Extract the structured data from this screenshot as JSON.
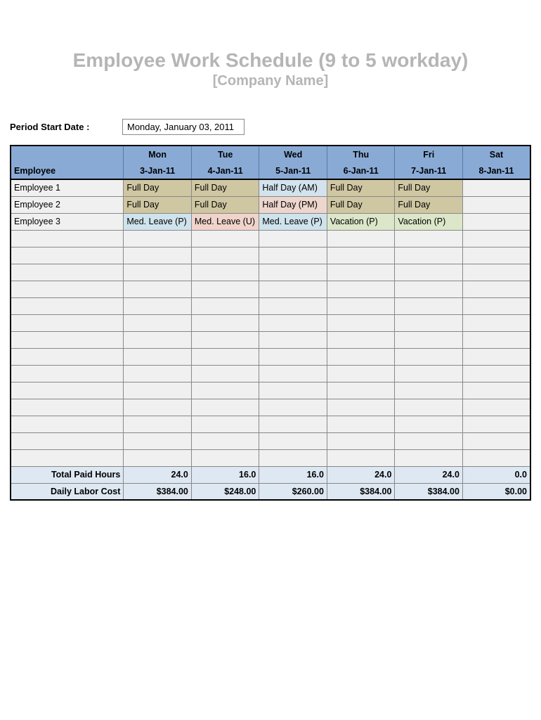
{
  "header": {
    "title": "Employee Work Schedule (9 to 5  workday)",
    "subtitle": "[Company Name]"
  },
  "period": {
    "label": "Period Start Date :",
    "value": "Monday, January 03, 2011"
  },
  "table": {
    "employee_header": "Employee",
    "days": [
      {
        "dow": "Mon",
        "date": "3-Jan-11"
      },
      {
        "dow": "Tue",
        "date": "4-Jan-11"
      },
      {
        "dow": "Wed",
        "date": "5-Jan-11"
      },
      {
        "dow": "Thu",
        "date": "6-Jan-11"
      },
      {
        "dow": "Fri",
        "date": "7-Jan-11"
      },
      {
        "dow": "Sat",
        "date": "8-Jan-11"
      }
    ],
    "rows": [
      {
        "employee": "Employee 1",
        "cells": [
          {
            "text": "Full Day",
            "cls": "c-fullday"
          },
          {
            "text": "Full Day",
            "cls": "c-fullday"
          },
          {
            "text": "Half Day (AM)",
            "cls": "c-halfam"
          },
          {
            "text": "Full Day",
            "cls": "c-fullday"
          },
          {
            "text": "Full Day",
            "cls": "c-fullday"
          },
          {
            "text": "",
            "cls": "c-none"
          }
        ]
      },
      {
        "employee": "Employee 2",
        "cells": [
          {
            "text": "Full Day",
            "cls": "c-fullday"
          },
          {
            "text": "Full Day",
            "cls": "c-fullday"
          },
          {
            "text": "Half Day (PM)",
            "cls": "c-halfpm"
          },
          {
            "text": "Full Day",
            "cls": "c-fullday"
          },
          {
            "text": "Full Day",
            "cls": "c-fullday"
          },
          {
            "text": "",
            "cls": "c-none"
          }
        ]
      },
      {
        "employee": "Employee 3",
        "cells": [
          {
            "text": "Med. Leave (P)",
            "cls": "c-medp"
          },
          {
            "text": "Med. Leave (U)",
            "cls": "c-medu"
          },
          {
            "text": "Med. Leave (P)",
            "cls": "c-medp"
          },
          {
            "text": "Vacation (P)",
            "cls": "c-vacp"
          },
          {
            "text": "Vacation (P)",
            "cls": "c-vacp"
          },
          {
            "text": "",
            "cls": "c-none"
          }
        ]
      },
      {
        "employee": "",
        "cells": [
          {
            "text": "",
            "cls": "c-none"
          },
          {
            "text": "",
            "cls": "c-none"
          },
          {
            "text": "",
            "cls": "c-none"
          },
          {
            "text": "",
            "cls": "c-none"
          },
          {
            "text": "",
            "cls": "c-none"
          },
          {
            "text": "",
            "cls": "c-none"
          }
        ]
      },
      {
        "employee": "",
        "cells": [
          {
            "text": "",
            "cls": "c-none"
          },
          {
            "text": "",
            "cls": "c-none"
          },
          {
            "text": "",
            "cls": "c-none"
          },
          {
            "text": "",
            "cls": "c-none"
          },
          {
            "text": "",
            "cls": "c-none"
          },
          {
            "text": "",
            "cls": "c-none"
          }
        ]
      },
      {
        "employee": "",
        "cells": [
          {
            "text": "",
            "cls": "c-none"
          },
          {
            "text": "",
            "cls": "c-none"
          },
          {
            "text": "",
            "cls": "c-none"
          },
          {
            "text": "",
            "cls": "c-none"
          },
          {
            "text": "",
            "cls": "c-none"
          },
          {
            "text": "",
            "cls": "c-none"
          }
        ]
      },
      {
        "employee": "",
        "cells": [
          {
            "text": "",
            "cls": "c-none"
          },
          {
            "text": "",
            "cls": "c-none"
          },
          {
            "text": "",
            "cls": "c-none"
          },
          {
            "text": "",
            "cls": "c-none"
          },
          {
            "text": "",
            "cls": "c-none"
          },
          {
            "text": "",
            "cls": "c-none"
          }
        ]
      },
      {
        "employee": "",
        "cells": [
          {
            "text": "",
            "cls": "c-none"
          },
          {
            "text": "",
            "cls": "c-none"
          },
          {
            "text": "",
            "cls": "c-none"
          },
          {
            "text": "",
            "cls": "c-none"
          },
          {
            "text": "",
            "cls": "c-none"
          },
          {
            "text": "",
            "cls": "c-none"
          }
        ]
      },
      {
        "employee": "",
        "cells": [
          {
            "text": "",
            "cls": "c-none"
          },
          {
            "text": "",
            "cls": "c-none"
          },
          {
            "text": "",
            "cls": "c-none"
          },
          {
            "text": "",
            "cls": "c-none"
          },
          {
            "text": "",
            "cls": "c-none"
          },
          {
            "text": "",
            "cls": "c-none"
          }
        ]
      },
      {
        "employee": "",
        "cells": [
          {
            "text": "",
            "cls": "c-none"
          },
          {
            "text": "",
            "cls": "c-none"
          },
          {
            "text": "",
            "cls": "c-none"
          },
          {
            "text": "",
            "cls": "c-none"
          },
          {
            "text": "",
            "cls": "c-none"
          },
          {
            "text": "",
            "cls": "c-none"
          }
        ]
      },
      {
        "employee": "",
        "cells": [
          {
            "text": "",
            "cls": "c-none"
          },
          {
            "text": "",
            "cls": "c-none"
          },
          {
            "text": "",
            "cls": "c-none"
          },
          {
            "text": "",
            "cls": "c-none"
          },
          {
            "text": "",
            "cls": "c-none"
          },
          {
            "text": "",
            "cls": "c-none"
          }
        ]
      },
      {
        "employee": "",
        "cells": [
          {
            "text": "",
            "cls": "c-none"
          },
          {
            "text": "",
            "cls": "c-none"
          },
          {
            "text": "",
            "cls": "c-none"
          },
          {
            "text": "",
            "cls": "c-none"
          },
          {
            "text": "",
            "cls": "c-none"
          },
          {
            "text": "",
            "cls": "c-none"
          }
        ]
      },
      {
        "employee": "",
        "cells": [
          {
            "text": "",
            "cls": "c-none"
          },
          {
            "text": "",
            "cls": "c-none"
          },
          {
            "text": "",
            "cls": "c-none"
          },
          {
            "text": "",
            "cls": "c-none"
          },
          {
            "text": "",
            "cls": "c-none"
          },
          {
            "text": "",
            "cls": "c-none"
          }
        ]
      },
      {
        "employee": "",
        "cells": [
          {
            "text": "",
            "cls": "c-none"
          },
          {
            "text": "",
            "cls": "c-none"
          },
          {
            "text": "",
            "cls": "c-none"
          },
          {
            "text": "",
            "cls": "c-none"
          },
          {
            "text": "",
            "cls": "c-none"
          },
          {
            "text": "",
            "cls": "c-none"
          }
        ]
      },
      {
        "employee": "",
        "cells": [
          {
            "text": "",
            "cls": "c-none"
          },
          {
            "text": "",
            "cls": "c-none"
          },
          {
            "text": "",
            "cls": "c-none"
          },
          {
            "text": "",
            "cls": "c-none"
          },
          {
            "text": "",
            "cls": "c-none"
          },
          {
            "text": "",
            "cls": "c-none"
          }
        ]
      },
      {
        "employee": "",
        "cells": [
          {
            "text": "",
            "cls": "c-none"
          },
          {
            "text": "",
            "cls": "c-none"
          },
          {
            "text": "",
            "cls": "c-none"
          },
          {
            "text": "",
            "cls": "c-none"
          },
          {
            "text": "",
            "cls": "c-none"
          },
          {
            "text": "",
            "cls": "c-none"
          }
        ]
      },
      {
        "employee": "",
        "cells": [
          {
            "text": "",
            "cls": "c-none"
          },
          {
            "text": "",
            "cls": "c-none"
          },
          {
            "text": "",
            "cls": "c-none"
          },
          {
            "text": "",
            "cls": "c-none"
          },
          {
            "text": "",
            "cls": "c-none"
          },
          {
            "text": "",
            "cls": "c-none"
          }
        ]
      }
    ],
    "totals": {
      "hours_label": "Total Paid Hours",
      "hours": [
        "24.0",
        "16.0",
        "16.0",
        "24.0",
        "24.0",
        "0.0"
      ],
      "cost_label": "Daily Labor Cost",
      "cost": [
        "$384.00",
        "$248.00",
        "$260.00",
        "$384.00",
        "$384.00",
        "$0.00"
      ]
    }
  }
}
